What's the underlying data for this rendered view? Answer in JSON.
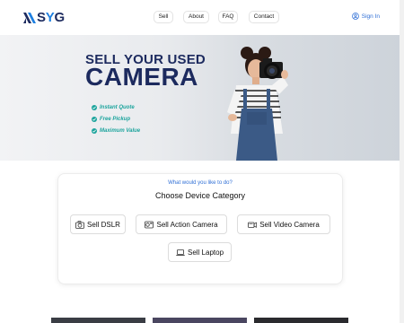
{
  "brand": {
    "logo_text_s": "S",
    "logo_text_y": "Y",
    "logo_text_g": "G",
    "logo_icon": "nsyg-logo-mark",
    "primary_color": "#1c2a5e",
    "accent_color": "#1e7fe0"
  },
  "nav": {
    "items": [
      {
        "label": "Sell"
      },
      {
        "label": "About"
      },
      {
        "label": "FAQ"
      },
      {
        "label": "Contact"
      }
    ],
    "signin_label": "Sign In",
    "signin_icon": "user-circle-icon"
  },
  "hero": {
    "title_line1": "SELL YOUR USED",
    "title_line2": "CAMERA",
    "features": [
      "Instant Quote",
      "Free Pickup",
      "Maximum Value"
    ],
    "feature_color": "#1ca49d",
    "feature_icon": "check-circle-icon"
  },
  "selector": {
    "subtitle": "What would you like to do?",
    "title": "Choose Device Category",
    "categories": [
      {
        "label": "Sell DSLR",
        "icon": "dslr-camera-icon"
      },
      {
        "label": "Sell Action Camera",
        "icon": "action-camera-icon"
      },
      {
        "label": "Sell Video Camera",
        "icon": "video-camera-icon"
      },
      {
        "label": "Sell Laptop",
        "icon": "laptop-icon"
      }
    ]
  }
}
